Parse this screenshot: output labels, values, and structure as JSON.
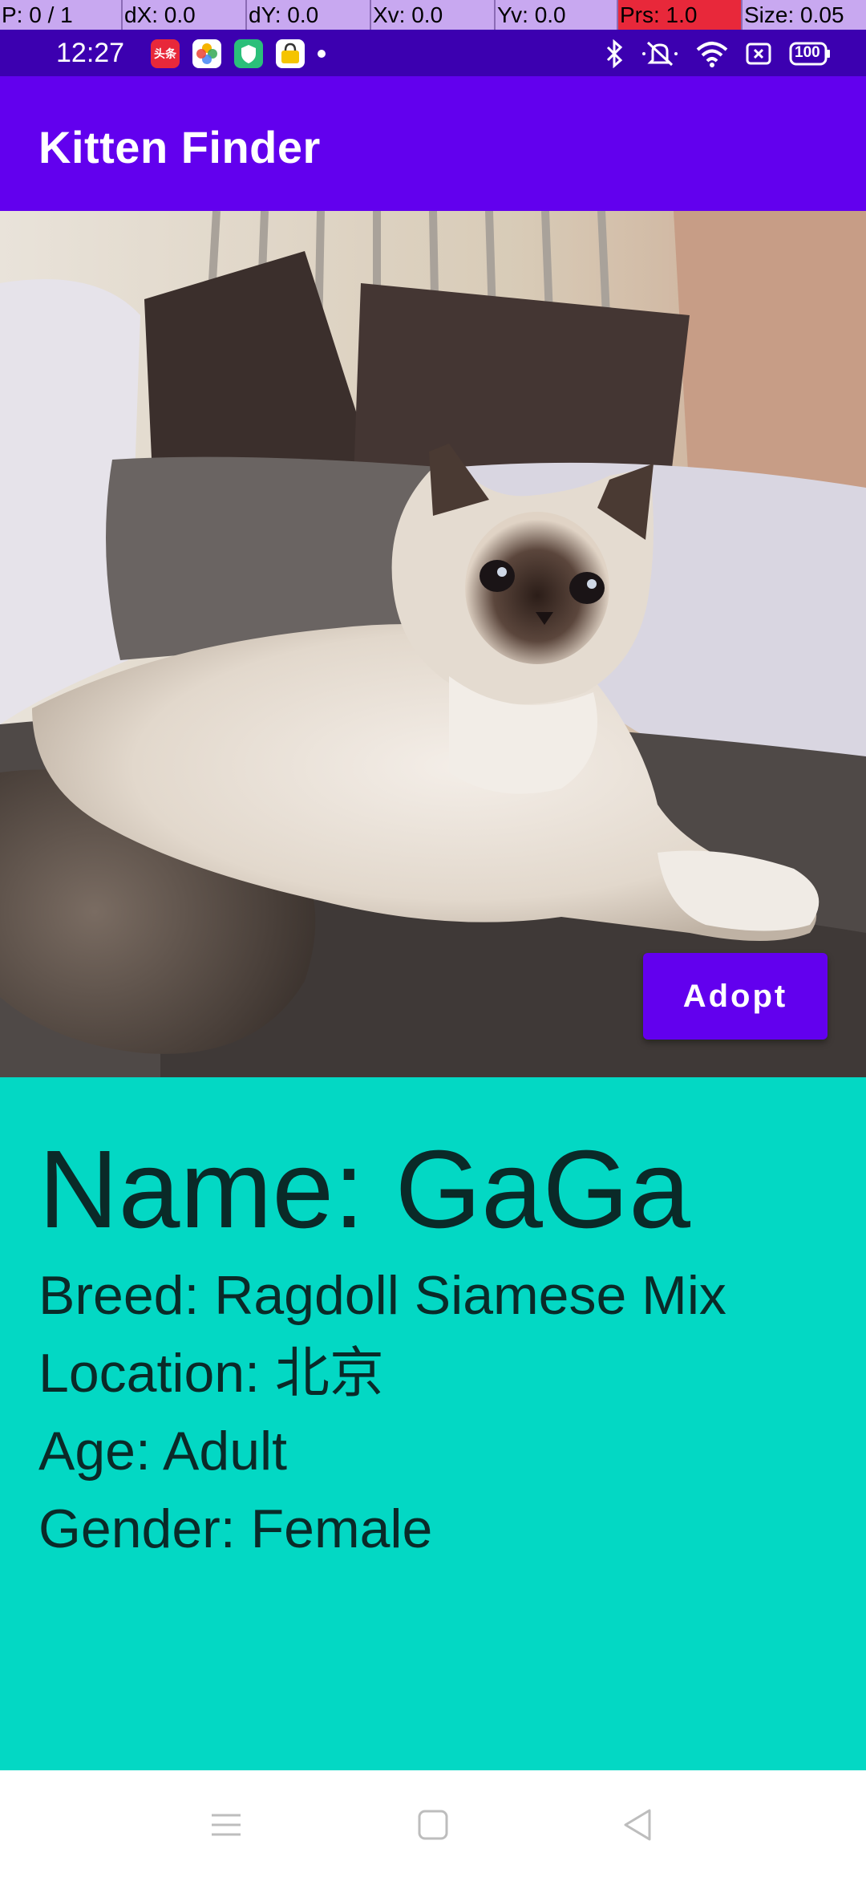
{
  "debug_bar": {
    "pointer": "P: 0 / 1",
    "dx": "dX: 0.0",
    "dy": "dY: 0.0",
    "xv": "Xv: 0.0",
    "yv": "Yv: 0.0",
    "prs": "Prs: 1.0",
    "size": "Size: 0.05"
  },
  "status_bar": {
    "time": "12:27",
    "notifications": [
      {
        "icon": "toutiao-app-icon",
        "label": "头条"
      },
      {
        "icon": "photos-app-icon",
        "label": ""
      },
      {
        "icon": "security-app-icon",
        "label": ""
      },
      {
        "icon": "store-app-icon",
        "label": ""
      }
    ],
    "battery": "100"
  },
  "app_bar": {
    "title": "Kitten Finder"
  },
  "photo": {
    "subject": "cat-photo"
  },
  "adopt": {
    "label": "Adopt"
  },
  "cat": {
    "name": "Name: GaGa",
    "breed": "Breed: Ragdoll Siamese Mix",
    "location": "Location: 北京",
    "age": "Age: Adult",
    "gender": "Gender: Female"
  },
  "nav_bar": {
    "icons": [
      "menu-icon",
      "home-icon",
      "back-icon"
    ]
  },
  "colors": {
    "primary": "#6200ee",
    "status_bar": "#3c00b0",
    "info_panel": "#03d8c4"
  }
}
